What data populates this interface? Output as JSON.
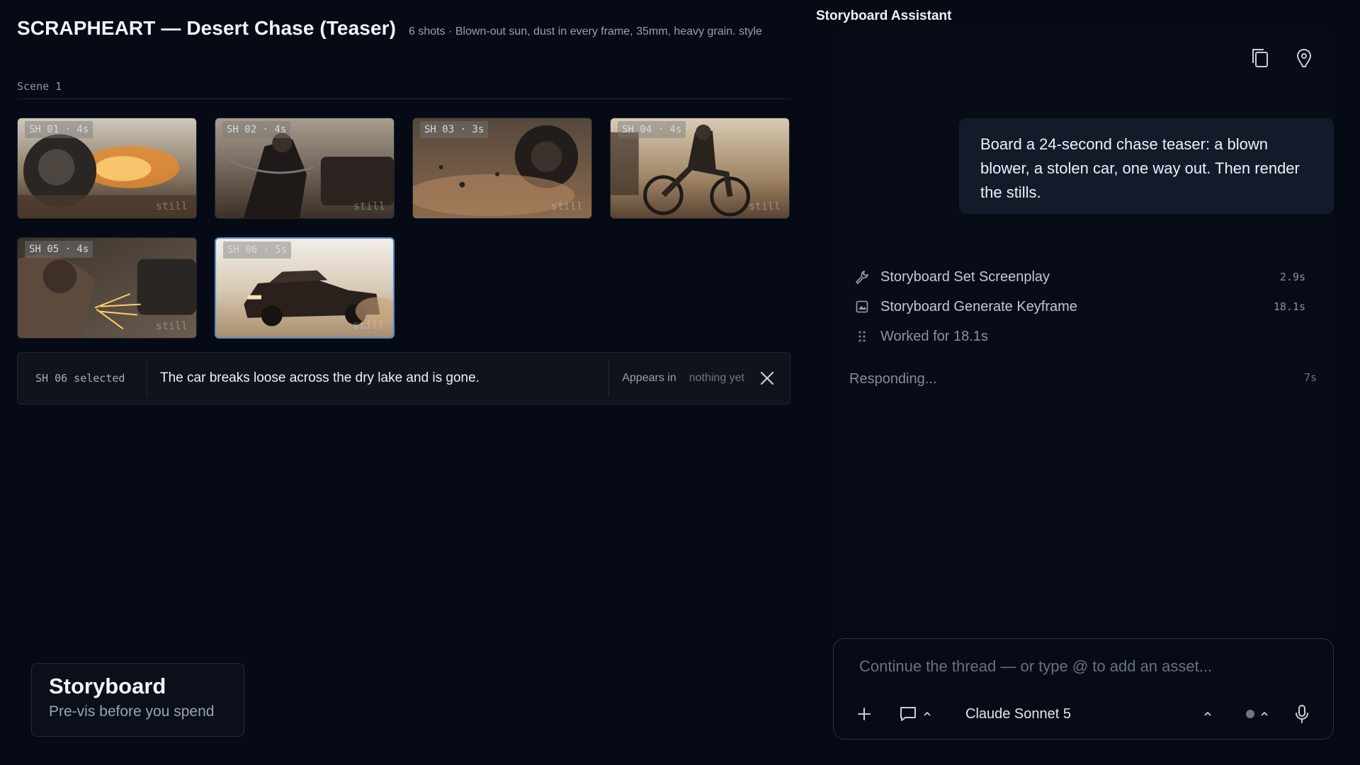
{
  "project": {
    "title": "SCRAPHEART — Desert Chase (Teaser)",
    "subtitle": "6 shots · Blown-out sun, dust in every frame, 35mm, heavy grain. style"
  },
  "scene": {
    "label": "Scene 1"
  },
  "shots": [
    {
      "tag": "SH 01 · 4s",
      "still": "still",
      "selected": false
    },
    {
      "tag": "SH 02 · 4s",
      "still": "still",
      "selected": false
    },
    {
      "tag": "SH 03 · 3s",
      "still": "still",
      "selected": false
    },
    {
      "tag": "SH 04 · 4s",
      "still": "still",
      "selected": false
    },
    {
      "tag": "SH 05 · 4s",
      "still": "still",
      "selected": false
    },
    {
      "tag": "SH 06 · 5s",
      "still": "still",
      "selected": true
    }
  ],
  "selection": {
    "label": "SH 06 selected",
    "description": "The car breaks loose across the dry lake and is gone.",
    "appears_label": "Appears in",
    "appears_value": "nothing yet"
  },
  "brand": {
    "title": "Storyboard",
    "subtitle": "Pre-vis before you spend"
  },
  "assistant": {
    "title": "Storyboard Assistant",
    "user_message": "Board a 24-second chase teaser: a blown blower, a stolen car, one way out. Then render the stills.",
    "activity": [
      {
        "icon": "wrench-icon",
        "label": "Storyboard Set Screenplay",
        "time": "2.9s"
      },
      {
        "icon": "image-icon",
        "label": "Storyboard Generate Keyframe",
        "time": "18.1s"
      },
      {
        "icon": "drag-dots-icon",
        "label": "Worked for 18.1s",
        "time": ""
      }
    ],
    "responding": {
      "label": "Responding...",
      "time": "7s"
    }
  },
  "composer": {
    "placeholder": "Continue the thread — or type @ to add an asset...",
    "model": "Claude Sonnet 5"
  },
  "colors": {
    "accent": "#4a8fd6",
    "background": "#050a14",
    "panel": "#070c16",
    "bubble": "#131b2b"
  }
}
